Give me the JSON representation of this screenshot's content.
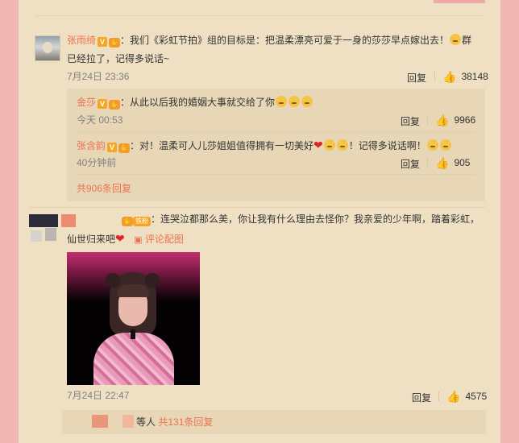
{
  "comment1": {
    "username": "张雨绮",
    "v_badge": "V",
    "text_line1": "：我们《彩虹节拍》组的目标是：把温柔漂亮可爱于一身的莎莎早点嫁出去！",
    "text_tail": "群",
    "text_line2": "已经拉了，记得多说话~",
    "time": "7月24日 23:36",
    "reply_label": "回复",
    "likes": "38148",
    "replies": [
      {
        "username": "金莎",
        "v_badge": "V",
        "text": "：从此以后我的婚姻大事就交给了你",
        "time": "今天 00:53",
        "reply_label": "回复",
        "likes": "9966"
      },
      {
        "username": "张含韵",
        "v_badge": "V",
        "text": "：对！温柔可人儿莎姐姐值得拥有一切美好",
        "text_tail": "！记得多说话啊！",
        "time": "40分钟前",
        "reply_label": "回复",
        "likes": "905"
      }
    ],
    "more_replies": "共906条回复"
  },
  "comment2": {
    "fan_badge": "铁粉",
    "text_line1": "：连哭泣都那么美，你让我有什么理由去怪你？我亲爱的少年啊，踏着彩虹，",
    "text_line2": "仙世归来吧",
    "view_image": "评论配图",
    "time": "7月24日 22:47",
    "reply_label": "回复",
    "likes": "4575",
    "footer_suffix": "等人",
    "footer_count": "共131条回复"
  },
  "icons": {
    "like": "thumbs-up-icon",
    "heart": "heart-icon",
    "image": "image-icon"
  },
  "colors": {
    "page_bg": "#f2b7b2",
    "panel_bg": "#efe0c4",
    "link": "#eb7350"
  }
}
